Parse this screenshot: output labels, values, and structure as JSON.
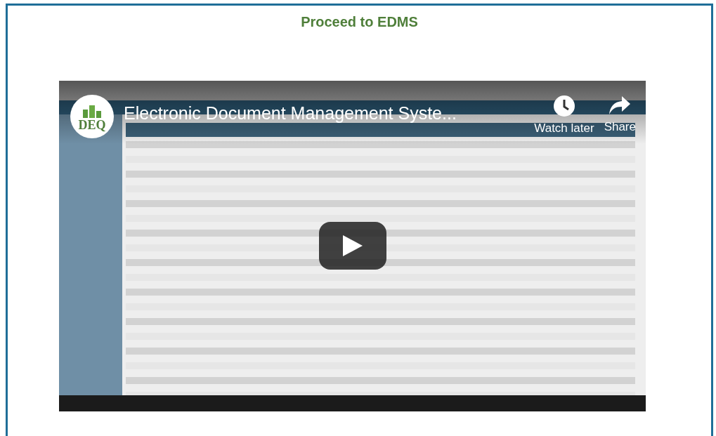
{
  "page": {
    "title": "Proceed to EDMS"
  },
  "video": {
    "kind": "picture",
    "title": "Electronic Document Management Syste...",
    "channel_logo": "DEQ",
    "actions": [
      {
        "kind": "clock",
        "label": "Watch later"
      },
      {
        "kind": "share",
        "label": "Share"
      }
    ]
  }
}
